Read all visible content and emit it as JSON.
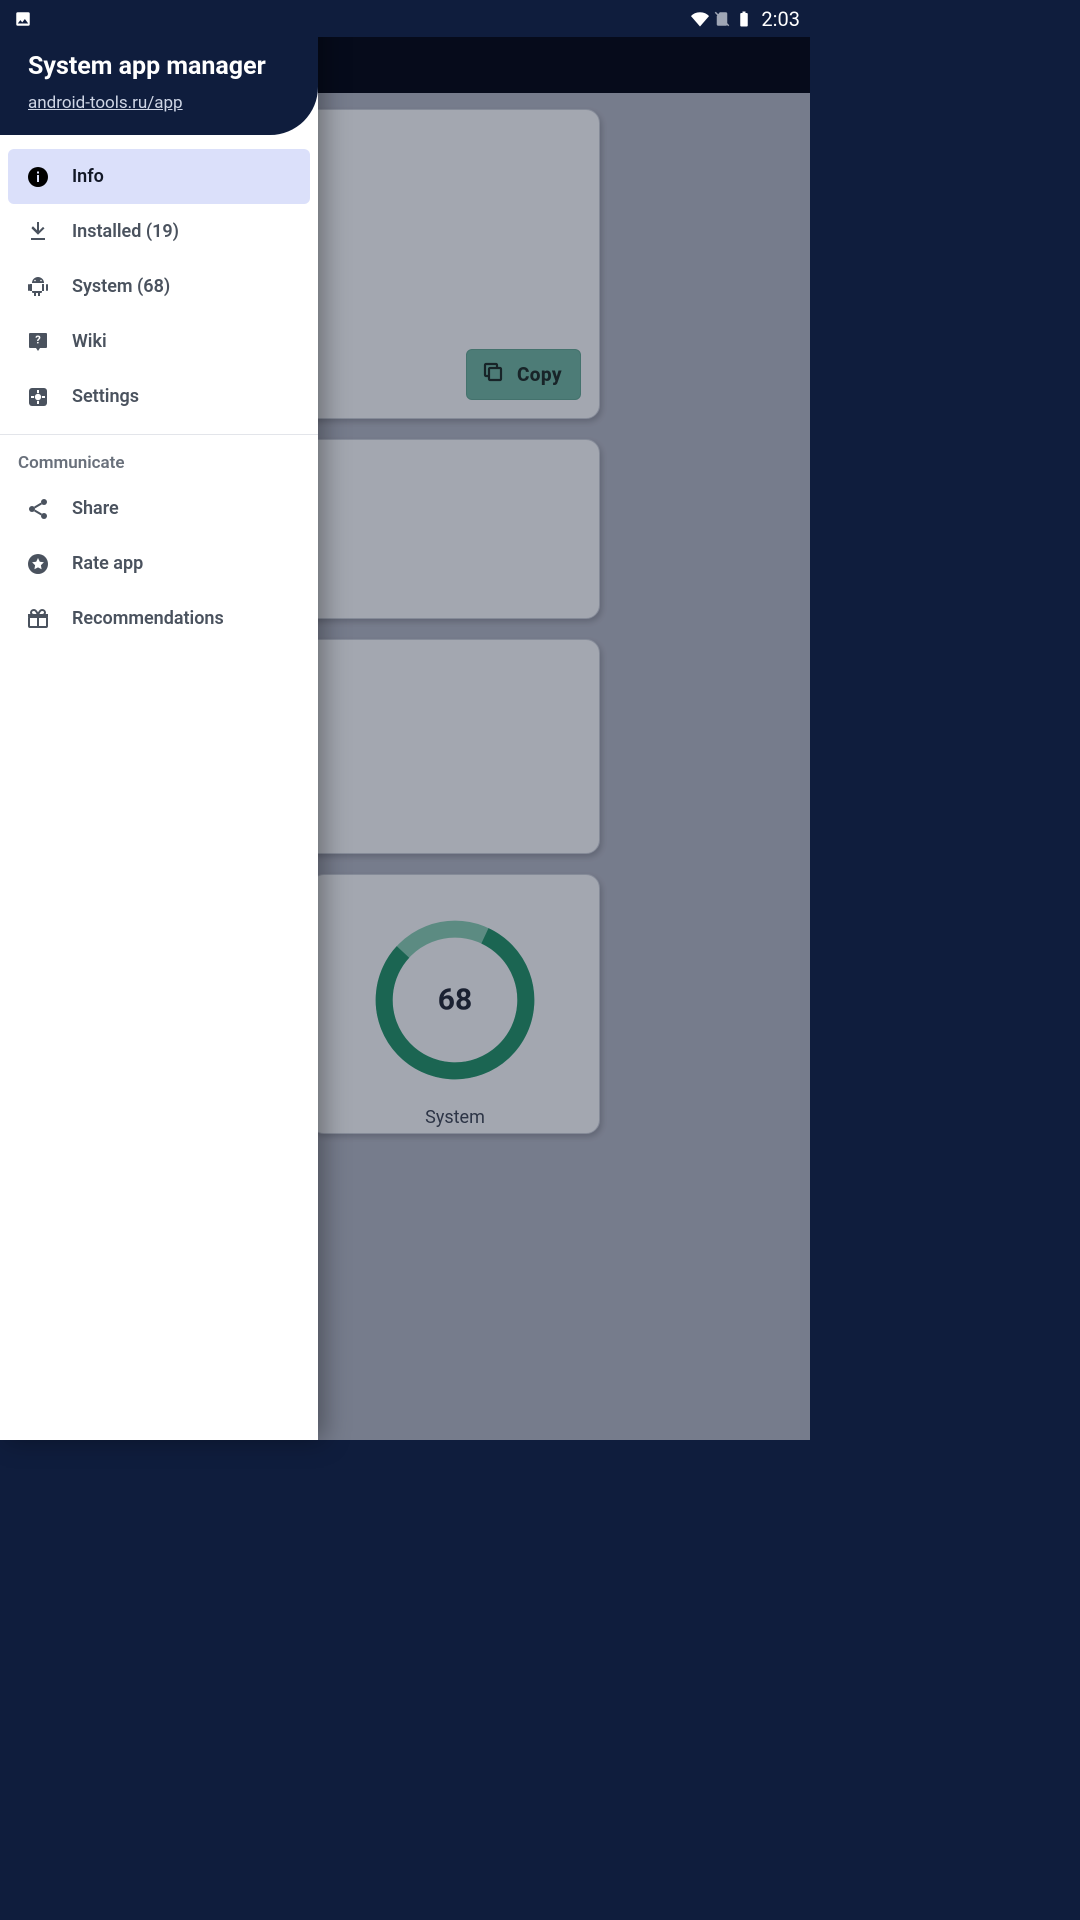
{
  "statusbar": {
    "time": "2:03"
  },
  "drawer": {
    "title": "System app manager",
    "link": "android-tools.ru/app",
    "items": {
      "info": "Info",
      "installed": "Installed (19)",
      "system": "System (68)",
      "wiki": "Wiki",
      "settings": "Settings"
    },
    "section_header": "Communicate",
    "communicate": {
      "share": "Share",
      "rate": "Rate app",
      "recommendations": "Recommendations"
    }
  },
  "main": {
    "copy_label": "Copy",
    "donut": {
      "value": "68",
      "label": "System"
    }
  },
  "chart_data": {
    "type": "pie",
    "title": "System",
    "series": [
      {
        "name": "System",
        "value": 68
      }
    ],
    "center_value": 68
  }
}
